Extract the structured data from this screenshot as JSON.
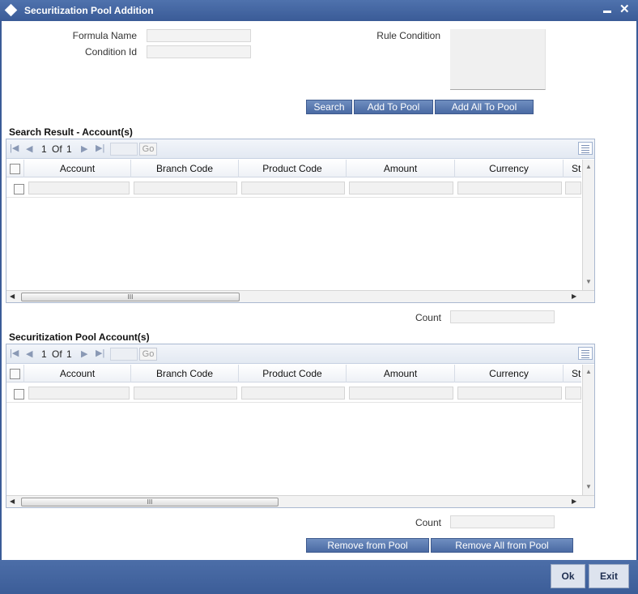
{
  "window": {
    "title": "Securitization Pool Addition",
    "minimize_glyph": "▬",
    "close_glyph": "✕"
  },
  "form": {
    "formula_name_label": "Formula Name",
    "formula_name_value": "",
    "condition_id_label": "Condition Id",
    "condition_id_value": "",
    "rule_condition_label": "Rule Condition",
    "rule_condition_value": ""
  },
  "actions": {
    "search": "Search",
    "add_to_pool": "Add To Pool",
    "add_all_to_pool": "Add All To Pool"
  },
  "search_result": {
    "title": "Search Result - Account(s)",
    "pager": {
      "current": "1",
      "of_label": "Of",
      "total": "1",
      "go": "Go"
    },
    "columns": [
      "Account",
      "Branch Code",
      "Product Code",
      "Amount",
      "Currency",
      "St"
    ],
    "count_label": "Count",
    "count_value": "",
    "scroll_grip": "III"
  },
  "pool_accounts": {
    "title": "Securitization Pool Account(s)",
    "pager": {
      "current": "1",
      "of_label": "Of",
      "total": "1",
      "go": "Go"
    },
    "columns": [
      "Account",
      "Branch Code",
      "Product Code",
      "Amount",
      "Currency",
      "St"
    ],
    "count_label": "Count",
    "count_value": "",
    "scroll_grip": "III"
  },
  "remove": {
    "remove_from_pool": "Remove from Pool",
    "remove_all_from_pool": "Remove All from Pool"
  },
  "footer": {
    "ok": "Ok",
    "exit": "Exit"
  },
  "icons": {
    "first": "first-page-icon",
    "prev": "previous-page-icon",
    "next": "next-page-icon",
    "last": "last-page-icon",
    "settings": "column-settings-icon"
  },
  "colors": {
    "titlebar": "#3a5b97",
    "button": "#4a6aa3",
    "footer": "#3c5d98"
  }
}
